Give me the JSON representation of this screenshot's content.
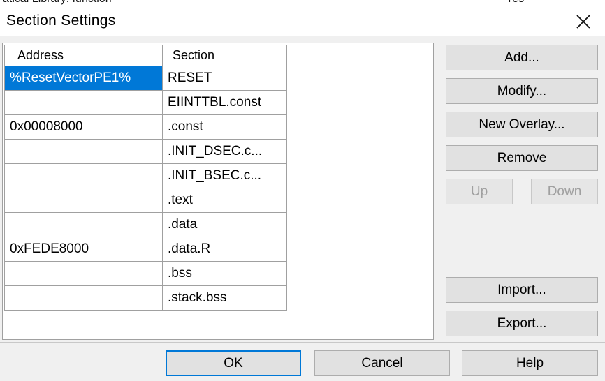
{
  "background": {
    "snippet_left": "atical Library: function",
    "snippet_right": "Yes"
  },
  "dialog": {
    "title": "Section Settings",
    "icons": {
      "close": "close-icon"
    }
  },
  "table": {
    "headers": [
      "Address",
      "Section"
    ],
    "rows": [
      {
        "address": "%ResetVectorPE1%",
        "section": "RESET",
        "selected": true
      },
      {
        "address": "",
        "section": "EIINTTBL.const"
      },
      {
        "address": "0x00008000",
        "section": ".const"
      },
      {
        "address": "",
        "section": ".INIT_DSEC.c..."
      },
      {
        "address": "",
        "section": ".INIT_BSEC.c..."
      },
      {
        "address": "",
        "section": ".text"
      },
      {
        "address": "",
        "section": ".data"
      },
      {
        "address": "0xFEDE8000",
        "section": ".data.R"
      },
      {
        "address": "",
        "section": ".bss"
      },
      {
        "address": "",
        "section": ".stack.bss"
      }
    ]
  },
  "buttons": {
    "add": "Add...",
    "modify": "Modify...",
    "new_overlay": "New Overlay...",
    "remove": "Remove",
    "up": "Up",
    "down": "Down",
    "import": "Import...",
    "export": "Export...",
    "ok": "OK",
    "cancel": "Cancel",
    "help": "Help"
  },
  "colors": {
    "selection": "#0078d7",
    "dialog_bg": "#f0f0f0",
    "grid_line": "#a0a0a0",
    "disabled_text": "#a0a0a0"
  }
}
